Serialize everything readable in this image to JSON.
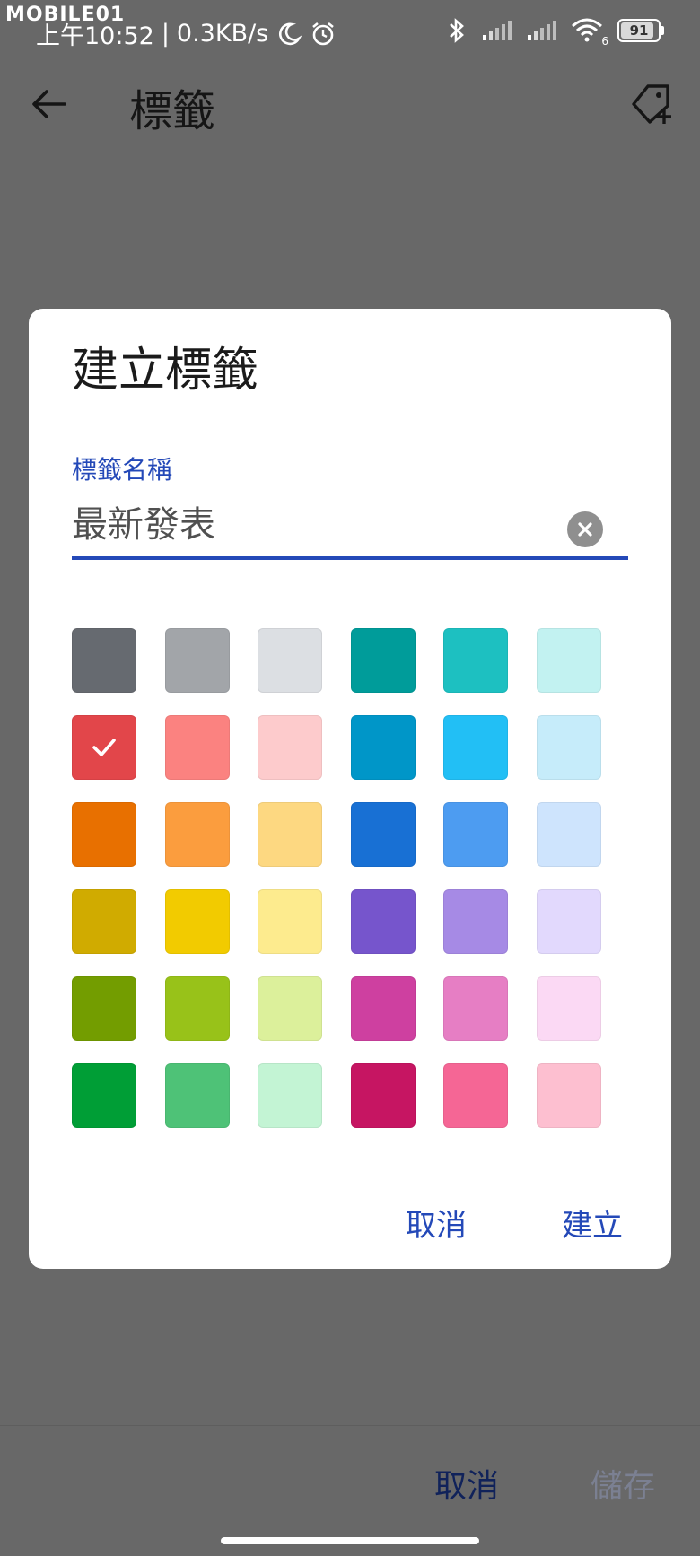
{
  "status_bar": {
    "watermark": "MOBILE01",
    "time": "上午10:52",
    "network_speed": "0.3KB/s",
    "separator": "|",
    "battery_level": "91",
    "wifi_badge": "6"
  },
  "app_bar": {
    "title": "標籤"
  },
  "dialog": {
    "title": "建立標籤",
    "field_label": "標籤名稱",
    "field_value": "最新發表",
    "cancel_label": "取消",
    "create_label": "建立",
    "selected_color_index": 6,
    "colors": [
      "#666a70",
      "#a2a5a9",
      "#dcdfe3",
      "#009c9a",
      "#1dc0c1",
      "#c2f2f1",
      "#e2464a",
      "#fb8280",
      "#fdcbcc",
      "#0096c8",
      "#22bff5",
      "#c6ecfa",
      "#e87000",
      "#fb9d3e",
      "#fdd881",
      "#1870d4",
      "#4d9cf1",
      "#cee4fd",
      "#d0ab00",
      "#f2cb00",
      "#fdeb8e",
      "#7655cc",
      "#a68ae5",
      "#e2d9fd",
      "#739d00",
      "#98c219",
      "#dcf09b",
      "#ce40a0",
      "#e67ec4",
      "#fbd9f4",
      "#009e36",
      "#4ec277",
      "#c3f4d4",
      "#c61562",
      "#f56695",
      "#fdbfd0"
    ]
  },
  "bottom_bar": {
    "cancel_label": "取消",
    "save_label": "儲存"
  }
}
